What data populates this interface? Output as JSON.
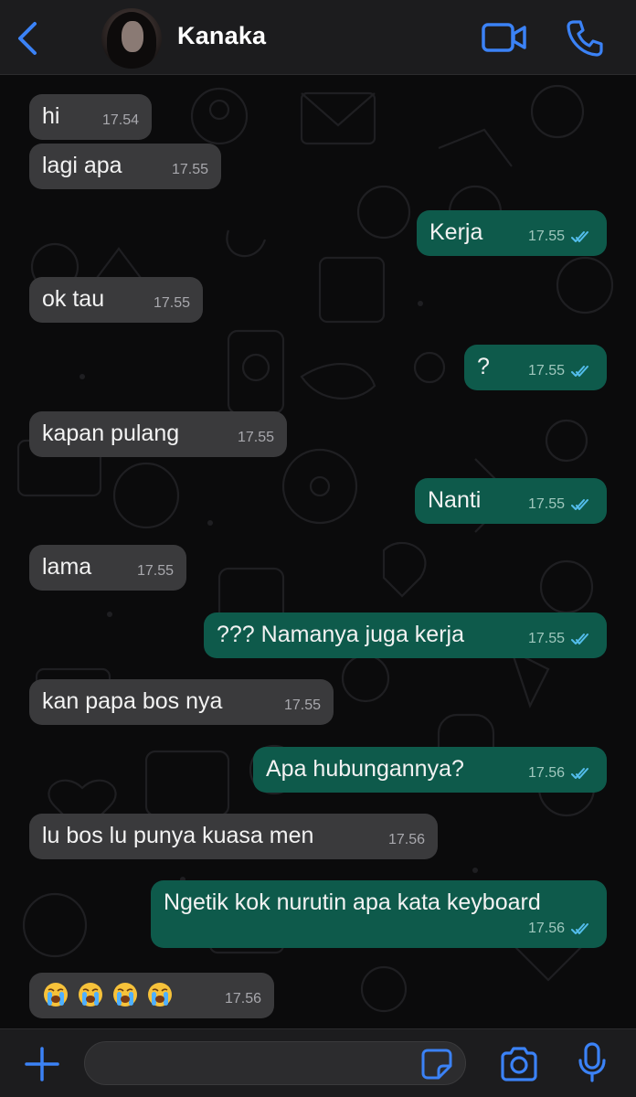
{
  "header": {
    "contact_name": "Kanaka"
  },
  "colors": {
    "accent": "#3b82f6",
    "incoming_bubble": "#3a3a3c",
    "outgoing_bubble": "#0e5a4b",
    "read_ticks": "#53bdeb"
  },
  "messages": [
    {
      "dir": "in",
      "text": "hi",
      "time": "17.54"
    },
    {
      "dir": "in",
      "text": "lagi apa",
      "time": "17.55"
    },
    {
      "dir": "out",
      "text": "Kerja",
      "time": "17.55",
      "status": "read"
    },
    {
      "dir": "in",
      "text": "ok tau",
      "time": "17.55"
    },
    {
      "dir": "out",
      "text": "?",
      "time": "17.55",
      "status": "read"
    },
    {
      "dir": "in",
      "text": "kapan pulang",
      "time": "17.55"
    },
    {
      "dir": "out",
      "text": "Nanti",
      "time": "17.55",
      "status": "read"
    },
    {
      "dir": "in",
      "text": "lama",
      "time": "17.55"
    },
    {
      "dir": "out",
      "text": "??? Namanya juga kerja",
      "time": "17.55",
      "status": "read"
    },
    {
      "dir": "in",
      "text": "kan papa bos nya",
      "time": "17.55"
    },
    {
      "dir": "out",
      "text": "Apa hubungannya?",
      "time": "17.56",
      "status": "read"
    },
    {
      "dir": "in",
      "text": "lu bos lu punya kuasa men",
      "time": "17.56"
    },
    {
      "dir": "out",
      "text": "Ngetik kok nurutin apa kata keyboard",
      "time": "17.56",
      "status": "read"
    },
    {
      "dir": "in",
      "emoji": [
        "loudly-crying-face",
        "loudly-crying-face",
        "loudly-crying-face",
        "loudly-crying-face"
      ],
      "time": "17.56"
    }
  ],
  "composer": {
    "input_value": "",
    "input_placeholder": ""
  },
  "icons": {
    "back": "chevron-left-icon",
    "video": "video-camera-icon",
    "call": "phone-icon",
    "attach": "plus-icon",
    "sticker": "sticker-icon",
    "camera": "camera-icon",
    "mic": "microphone-icon"
  }
}
